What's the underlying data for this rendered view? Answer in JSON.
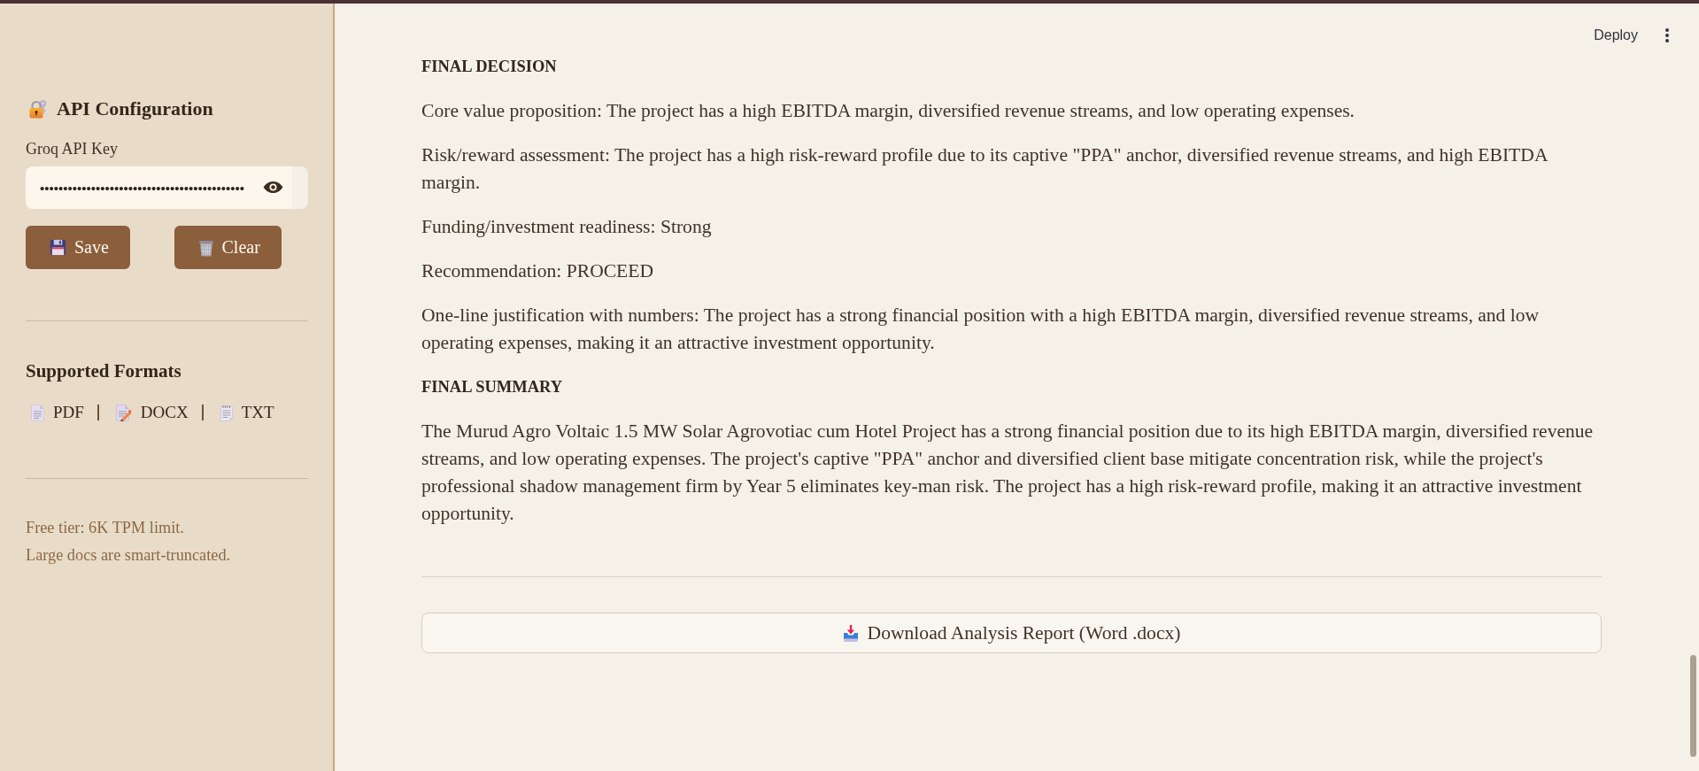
{
  "sidebar": {
    "api_configuration": {
      "title": "API Configuration",
      "field_label": "Groq API Key",
      "api_key_field": {
        "value": "••••••••••••••••••••••••••••••••••••••••••••"
      },
      "buttons": [
        {
          "label": "Save",
          "kind": "save"
        },
        {
          "label": "Clear",
          "kind": "clear"
        }
      ]
    },
    "supported_formats": {
      "title": "Supported Formats",
      "formats": [
        {
          "label": "PDF",
          "kind": "pdf"
        },
        {
          "label": "DOCX",
          "kind": "docx"
        },
        {
          "label": "TXT",
          "kind": "txt"
        }
      ]
    },
    "notes": [
      "Free tier: 6K TPM limit.",
      "Large docs are smart-truncated."
    ]
  },
  "header": {
    "deploy_button": "Deploy"
  },
  "report": {
    "blocks": [
      {
        "kind": "heading",
        "text": "FINAL DECISION"
      },
      {
        "kind": "paragraph",
        "text": "Core value proposition: The project has a high EBITDA margin, diversified revenue streams, and low operating expenses."
      },
      {
        "kind": "paragraph",
        "text": "Risk/reward assessment: The project has a high risk-reward profile due to its captive \"PPA\" anchor, diversified revenue streams, and high EBITDA margin."
      },
      {
        "kind": "paragraph",
        "text": "Funding/investment readiness: Strong"
      },
      {
        "kind": "paragraph",
        "text": "Recommendation: PROCEED"
      },
      {
        "kind": "paragraph",
        "text": "One-line justification with numbers: The project has a strong financial position with a high EBITDA margin, diversified revenue streams, and low operating expenses, making it an attractive investment opportunity."
      },
      {
        "kind": "heading",
        "text": "FINAL SUMMARY"
      },
      {
        "kind": "paragraph",
        "text": "The Murud Agro Voltaic 1.5 MW Solar Agrovotiac cum Hotel Project has a strong financial position due to its high EBITDA margin, diversified revenue streams, and low operating expenses. The project's captive \"PPA\" anchor and diversified client base mitigate concentration risk, while the project's professional shadow management firm by Year 5 eliminates key-man risk. The project has a high risk-reward profile, making it an attractive investment opportunity."
      }
    ]
  },
  "download_button": {
    "label": "Download Analysis Report (Word .docx)"
  }
}
